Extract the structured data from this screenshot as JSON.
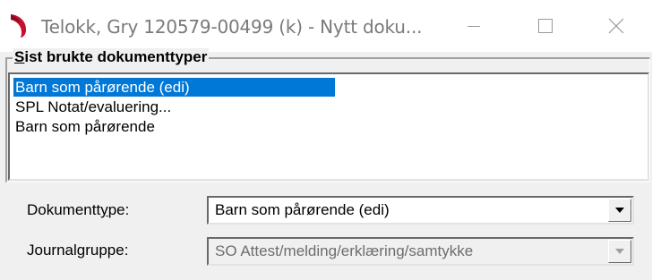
{
  "window": {
    "title": "Telokk, Gry  120579-00499 (k) - Nytt doku...",
    "accent_color": "#c8102e"
  },
  "group": {
    "label_mnemonic": "S",
    "label_rest": "ist brukte dokumenttyper",
    "items": [
      {
        "label": "Barn som pårørende (edi)",
        "selected": true
      },
      {
        "label": "SPL Notat/evaluering..."
      },
      {
        "label": "Barn som pårørende"
      }
    ]
  },
  "form": {
    "doktype": {
      "label_pre": "Dokumentt",
      "label_mnemonic": "y",
      "label_post": "pe:",
      "value": "Barn som pårørende (edi)"
    },
    "journal": {
      "label": "Journalgruppe:",
      "value": "SO Attest/melding/erklæring/samtykke",
      "enabled": false
    }
  },
  "colors": {
    "selection": "#0078d7",
    "dialog_bg": "#f0f0f0"
  }
}
